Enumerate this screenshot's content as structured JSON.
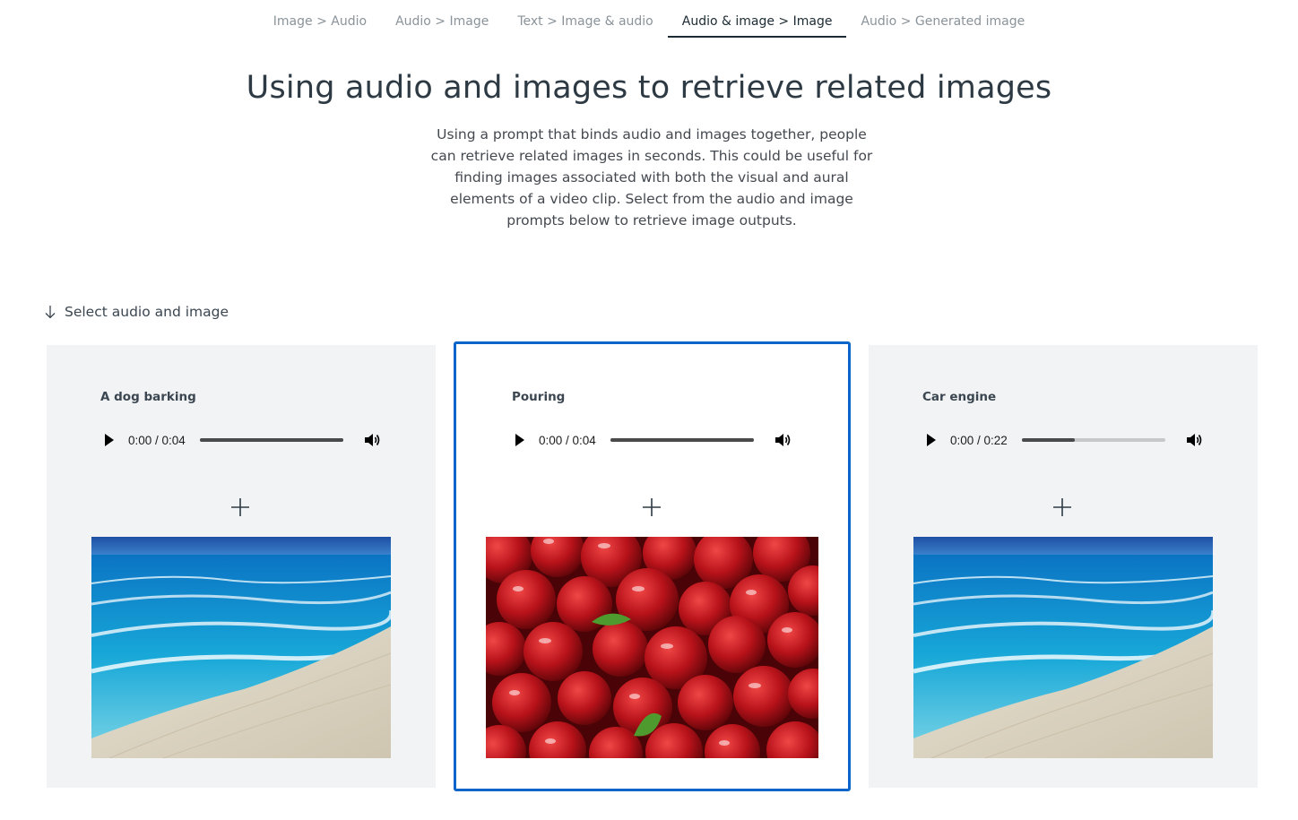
{
  "tabs": [
    {
      "label": "Image > Audio",
      "active": false
    },
    {
      "label": "Audio > Image",
      "active": false
    },
    {
      "label": "Text > Image & audio",
      "active": false
    },
    {
      "label": "Audio & image > Image",
      "active": true
    },
    {
      "label": "Audio > Generated image",
      "active": false
    }
  ],
  "header": {
    "title": "Using audio and images to retrieve related images",
    "description": "Using a prompt that binds audio and images together, people can retrieve related images in seconds. This could be useful for finding images associated with both the visual and aural elements of a video clip. Select from the audio and image prompts below to retrieve image outputs."
  },
  "section": {
    "label": "Select audio and image",
    "icon": "arrow-down-icon"
  },
  "cards": [
    {
      "title": "A dog barking",
      "time": "0:00 / 0:04",
      "progress": 1.0,
      "image": "beach-image",
      "selected": false
    },
    {
      "title": "Pouring",
      "time": "0:00 / 0:04",
      "progress": 1.0,
      "image": "red-apples-image",
      "selected": true
    },
    {
      "title": "Car engine",
      "time": "0:00 / 0:22",
      "progress": 0.37,
      "image": "beach-image",
      "selected": false
    }
  ],
  "colors": {
    "accent": "#0a64c9",
    "card_bg": "#f1f3f5",
    "text": "#1c2b33",
    "muted": "#8a939a"
  }
}
